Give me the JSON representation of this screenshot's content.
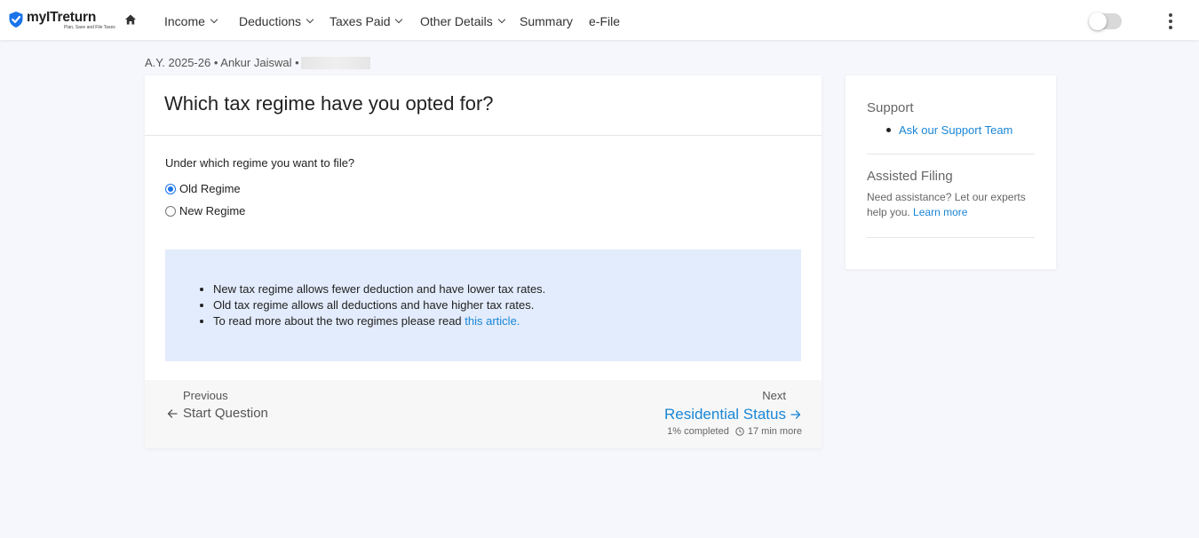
{
  "header": {
    "logo_text": "myITreturn",
    "logo_tagline": "Plan, Save and File Taxes",
    "nav": [
      {
        "label": "Income"
      },
      {
        "label": "Deductions"
      },
      {
        "label": "Taxes Paid"
      },
      {
        "label": "Other Details"
      },
      {
        "label": "Summary"
      },
      {
        "label": "e-File"
      }
    ],
    "toggle_on": false
  },
  "breadcrumb": {
    "text": "A.Y. 2025-26 • Ankur Jaiswal • "
  },
  "main": {
    "title": "Which tax regime have you opted for?",
    "question": "Under which regime you want to file?",
    "options": [
      {
        "label": "Old Regime",
        "selected": true
      },
      {
        "label": "New Regime",
        "selected": false
      }
    ],
    "info": {
      "line1": "New tax regime allows fewer deduction and have lower tax rates.",
      "line2": "Old tax regime allows all deductions and have higher tax rates.",
      "line3_prefix": "To read more about the two regimes please read ",
      "line3_link": "this article."
    },
    "footer": {
      "prev_label": "Previous",
      "prev_link": "Start Question",
      "next_label": "Next",
      "next_link": "Residential Status",
      "progress": "1% completed",
      "time_left": "17 min more"
    }
  },
  "sidebar": {
    "support_heading": "Support",
    "support_link": "Ask our Support Team",
    "assisted_heading": "Assisted Filing",
    "assisted_text": "Need assistance? Let our experts help you. ",
    "assisted_link": "Learn more"
  },
  "colors": {
    "accent": "#1a86d6",
    "info_bg": "#e3ecfc",
    "page_bg": "#f5f7fc"
  }
}
